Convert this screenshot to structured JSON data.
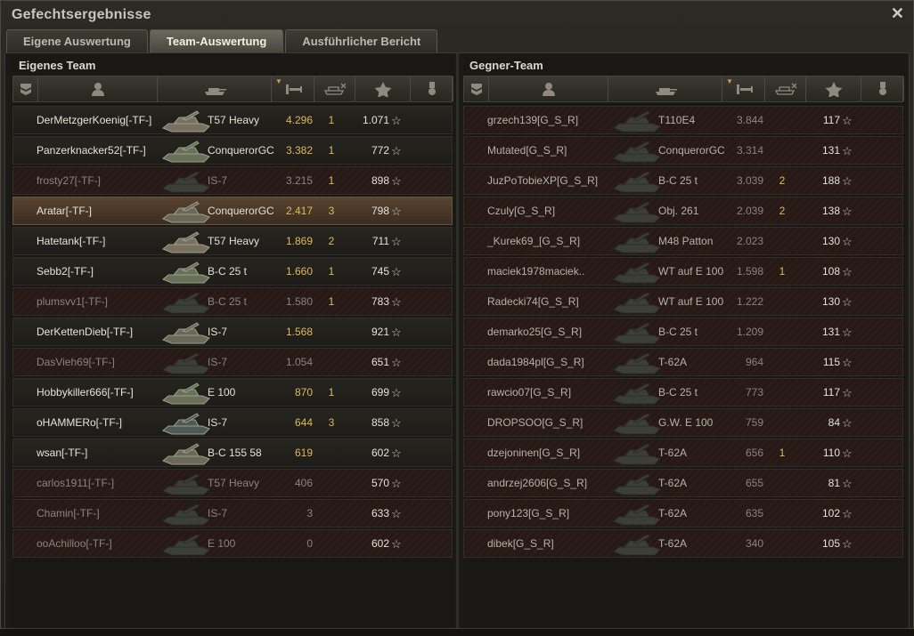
{
  "window": {
    "title": "Gefechtsergebnisse",
    "close_glyph": "✕"
  },
  "tabs": [
    {
      "label": "Eigene Auswertung",
      "active": false
    },
    {
      "label": "Team-Auswertung",
      "active": true
    },
    {
      "label": "Ausführlicher Bericht",
      "active": false
    }
  ],
  "own_team": {
    "title": "Eigenes Team",
    "rows": [
      {
        "name": "DerMetzgerKoenig[-TF-]",
        "tank": "T57 Heavy",
        "xp": "4.296",
        "kills": "1",
        "damage": "1.071",
        "dead": false,
        "me": false
      },
      {
        "name": "Panzerknacker52[-TF-]",
        "tank": "ConquerorGC",
        "xp": "3.382",
        "kills": "1",
        "damage": "772",
        "dead": false,
        "me": false
      },
      {
        "name": "frosty27[-TF-]",
        "tank": "IS-7",
        "xp": "3.215",
        "kills": "1",
        "damage": "898",
        "dead": true,
        "me": false
      },
      {
        "name": "Aratar[-TF-]",
        "tank": "ConquerorGC",
        "xp": "2.417",
        "kills": "3",
        "damage": "798",
        "dead": false,
        "me": true
      },
      {
        "name": "Hatetank[-TF-]",
        "tank": "T57 Heavy",
        "xp": "1.869",
        "kills": "2",
        "damage": "711",
        "dead": false,
        "me": false
      },
      {
        "name": "Sebb2[-TF-]",
        "tank": "B-C 25 t",
        "xp": "1.660",
        "kills": "1",
        "damage": "745",
        "dead": false,
        "me": false
      },
      {
        "name": "plumsvv1[-TF-]",
        "tank": "B-C 25 t",
        "xp": "1.580",
        "kills": "1",
        "damage": "783",
        "dead": true,
        "me": false
      },
      {
        "name": "DerKettenDieb[-TF-]",
        "tank": "IS-7",
        "xp": "1.568",
        "kills": "",
        "damage": "921",
        "dead": false,
        "me": false
      },
      {
        "name": "DasVieh69[-TF-]",
        "tank": "IS-7",
        "xp": "1.054",
        "kills": "",
        "damage": "651",
        "dead": true,
        "me": false
      },
      {
        "name": "Hobbykiller666[-TF-]",
        "tank": "E 100",
        "xp": "870",
        "kills": "1",
        "damage": "699",
        "dead": false,
        "me": false
      },
      {
        "name": "oHAMMERo[-TF-]",
        "tank": "IS-7",
        "xp": "644",
        "kills": "3",
        "damage": "858",
        "dead": false,
        "me": false
      },
      {
        "name": "wsan[-TF-]",
        "tank": "B-C 155 58",
        "xp": "619",
        "kills": "",
        "damage": "602",
        "dead": false,
        "me": false
      },
      {
        "name": "carlos1911[-TF-]",
        "tank": "T57 Heavy",
        "xp": "406",
        "kills": "",
        "damage": "570",
        "dead": true,
        "me": false
      },
      {
        "name": "Chamin[-TF-]",
        "tank": "IS-7",
        "xp": "3",
        "kills": "",
        "damage": "633",
        "dead": true,
        "me": false
      },
      {
        "name": "ooAchilloo[-TF-]",
        "tank": "E 100",
        "xp": "0",
        "kills": "",
        "damage": "602",
        "dead": true,
        "me": false
      }
    ]
  },
  "enemy_team": {
    "title": "Gegner-Team",
    "rows": [
      {
        "name": "grzech139[G_S_R]",
        "tank": "T110E4",
        "xp": "3.844",
        "kills": "",
        "damage": "117",
        "dead": true
      },
      {
        "name": "Mutated[G_S_R]",
        "tank": "ConquerorGC",
        "xp": "3.314",
        "kills": "",
        "damage": "131",
        "dead": true
      },
      {
        "name": "JuzPoTobieXP[G_S_R]",
        "tank": "B-C 25 t",
        "xp": "3.039",
        "kills": "2",
        "damage": "188",
        "dead": true
      },
      {
        "name": "Czuly[G_S_R]",
        "tank": "Obj. 261",
        "xp": "2.039",
        "kills": "2",
        "damage": "138",
        "dead": true
      },
      {
        "name": "_Kurek69_[G_S_R]",
        "tank": "M48 Patton",
        "xp": "2.023",
        "kills": "",
        "damage": "130",
        "dead": true
      },
      {
        "name": "maciek1978maciek..",
        "tank": "WT auf E 100",
        "xp": "1.598",
        "kills": "1",
        "damage": "108",
        "dead": true
      },
      {
        "name": "Radecki74[G_S_R]",
        "tank": "WT auf E 100",
        "xp": "1.222",
        "kills": "",
        "damage": "130",
        "dead": true
      },
      {
        "name": "demarko25[G_S_R]",
        "tank": "B-C 25 t",
        "xp": "1.209",
        "kills": "",
        "damage": "131",
        "dead": true
      },
      {
        "name": "dada1984pl[G_S_R]",
        "tank": "T-62A",
        "xp": "964",
        "kills": "",
        "damage": "115",
        "dead": true
      },
      {
        "name": "rawcio07[G_S_R]",
        "tank": "B-C 25 t",
        "xp": "773",
        "kills": "",
        "damage": "117",
        "dead": true
      },
      {
        "name": "DROPSOO[G_S_R]",
        "tank": "G.W. E 100",
        "xp": "759",
        "kills": "",
        "damage": "84",
        "dead": true
      },
      {
        "name": "dzejoninen[G_S_R]",
        "tank": "T-62A",
        "xp": "656",
        "kills": "1",
        "damage": "110",
        "dead": true
      },
      {
        "name": "andrzej2606[G_S_R]",
        "tank": "T-62A",
        "xp": "655",
        "kills": "",
        "damage": "81",
        "dead": true
      },
      {
        "name": "pony123[G_S_R]",
        "tank": "T-62A",
        "xp": "635",
        "kills": "",
        "damage": "102",
        "dead": true
      },
      {
        "name": "dibek[G_S_R]",
        "tank": "T-62A",
        "xp": "340",
        "kills": "",
        "damage": "105",
        "dead": true
      }
    ]
  },
  "star_glyph": "☆",
  "colors": {
    "accent": "#e0b85a",
    "dead_row": "#2a1c19",
    "own_row_highlight": "#5a4330"
  },
  "header_icons": [
    "rank-icon",
    "player-icon",
    "tank-icon",
    "xp-icon",
    "kills-icon",
    "star-icon",
    "medal-icon"
  ]
}
